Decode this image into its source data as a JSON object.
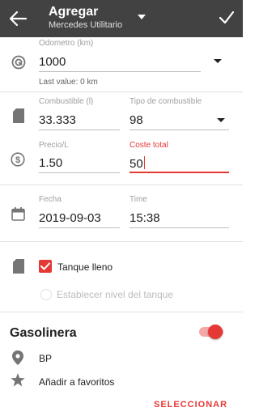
{
  "colors": {
    "toolbar_bg": "#424242",
    "accent": "#e53935",
    "icon": "#757575"
  },
  "toolbar": {
    "title": "Agregar",
    "subtitle": "Mercedes Utilitario",
    "back_icon": "arrow-left-icon",
    "dropdown_icon": "caret-down-icon",
    "save_icon": "check-icon"
  },
  "odometer": {
    "label": "Odometro (km)",
    "value": "1000",
    "hint": "Last value: 0 km",
    "icon": "odometer-icon"
  },
  "fuel": {
    "amount_label": "Combustible (l)",
    "amount_value": "33.333",
    "type_label": "Tipo de combustible",
    "type_value": "98",
    "icon": "fuel-can-icon"
  },
  "price": {
    "unit_label": "Precio/L",
    "unit_value": "1.50",
    "total_label": "Coste total",
    "total_value": "50",
    "icon": "dollar-icon"
  },
  "date": {
    "date_label": "Fecha",
    "date_value": "2019-09-03",
    "time_label": "Time",
    "time_value": "15:38",
    "icon": "calendar-icon"
  },
  "tank": {
    "full_label": "Tanque lleno",
    "full_checked": true,
    "level_label": "Establecer nivel del tanque",
    "icon": "fuel-can-icon"
  },
  "station": {
    "title": "Gasolinera",
    "enabled": true,
    "name": "BP",
    "favorite_label": "Añadir a favoritos",
    "select_label": "SELECCIONAR"
  }
}
